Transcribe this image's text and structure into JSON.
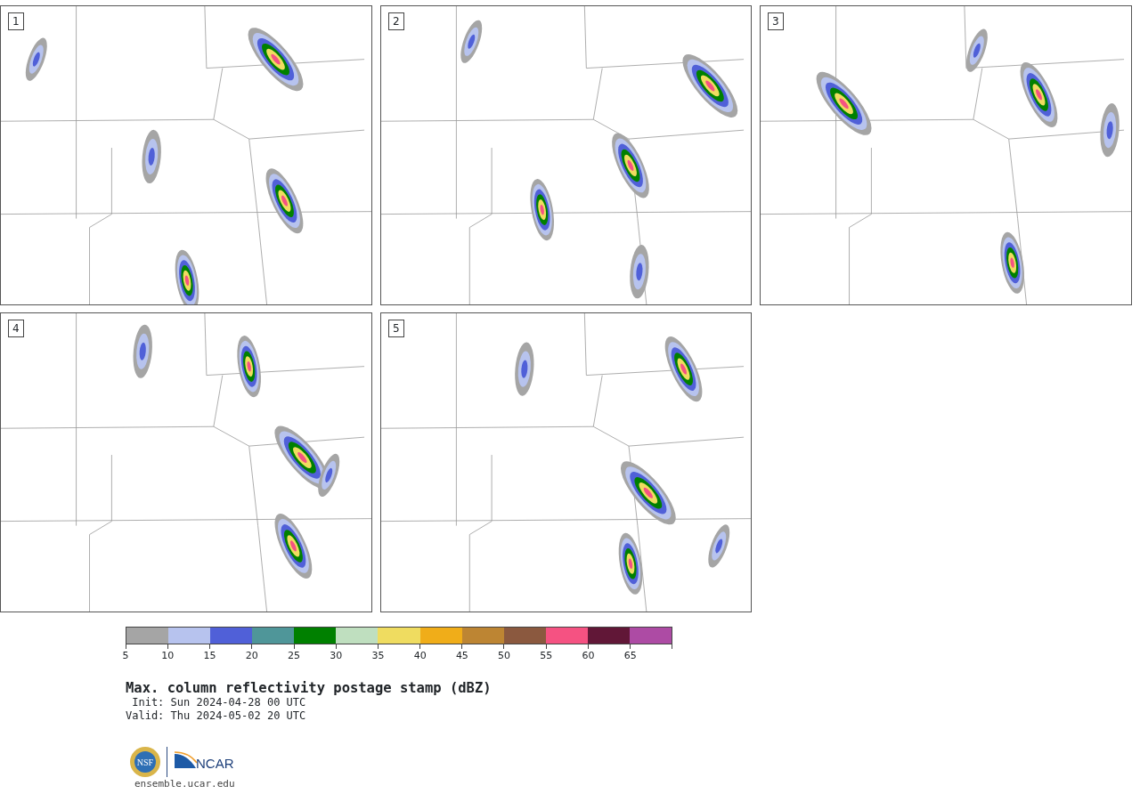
{
  "panels": [
    {
      "label": "1"
    },
    {
      "label": "2"
    },
    {
      "label": "3"
    },
    {
      "label": "4"
    },
    {
      "label": "5"
    }
  ],
  "colorbar": {
    "segments": [
      {
        "color": "#a5a5a5"
      },
      {
        "color": "#b7c3ee"
      },
      {
        "color": "#5060d8"
      },
      {
        "color": "#4f9699"
      },
      {
        "color": "#008000"
      },
      {
        "color": "#bfdfbf"
      },
      {
        "color": "#efdc60"
      },
      {
        "color": "#f0ad19"
      },
      {
        "color": "#bd8533"
      },
      {
        "color": "#8b593f"
      },
      {
        "color": "#f55282"
      },
      {
        "color": "#611737"
      },
      {
        "color": "#ad4ba4"
      }
    ],
    "ticks": [
      "5",
      "10",
      "15",
      "20",
      "25",
      "30",
      "35",
      "40",
      "45",
      "50",
      "55",
      "60",
      "65"
    ]
  },
  "title": "Max. column reflectivity postage stamp (dBZ)",
  "init": " Init: Sun 2024-04-28 00 UTC",
  "valid": "Valid: Thu 2024-05-02 20 UTC",
  "logos": {
    "nsf": "NSF",
    "ncar": "NCAR"
  },
  "url": "ensemble.ucar.edu"
}
